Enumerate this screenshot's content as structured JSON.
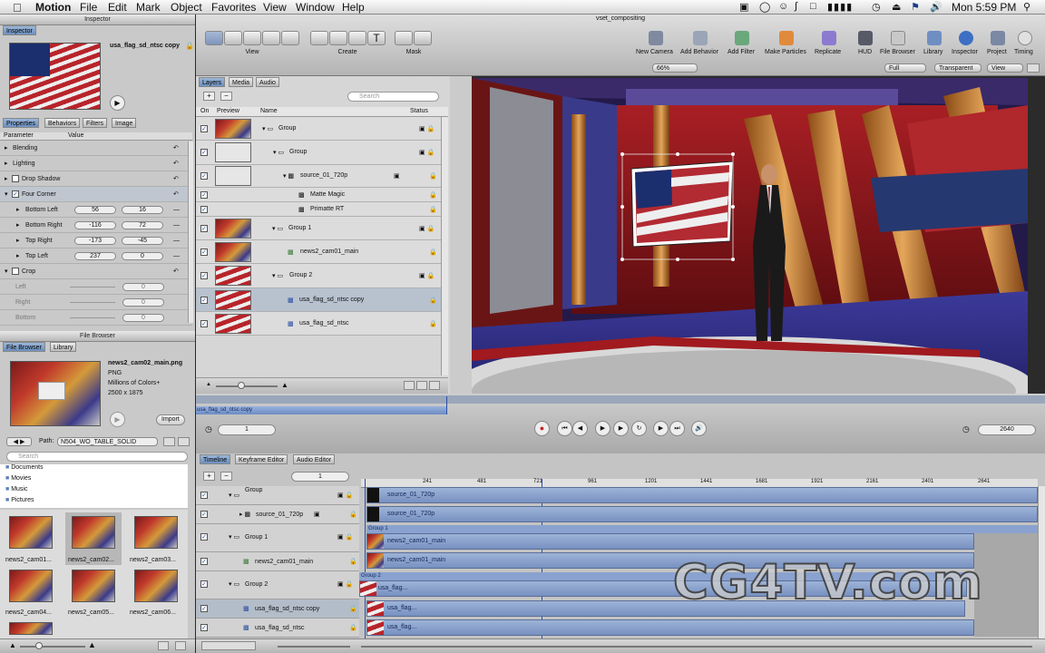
{
  "menubar": {
    "apple": "",
    "app": "Motion",
    "items": [
      "File",
      "Edit",
      "Mark",
      "Object",
      "Favorites",
      "View",
      "Window",
      "Help"
    ],
    "clock": "Mon 5:59 PM"
  },
  "inspector": {
    "title": "Inspector",
    "tab": "Inspector",
    "preview_name": "usa_flag_sd_ntsc copy",
    "tabs": [
      "Properties",
      "Behaviors",
      "Filters",
      "Image"
    ],
    "columns": [
      "Parameter",
      "Value"
    ],
    "params": [
      {
        "label": "Blending",
        "type": "group"
      },
      {
        "label": "Lighting",
        "type": "group"
      },
      {
        "label": "Drop Shadow",
        "type": "group"
      },
      {
        "label": "Four Corner",
        "type": "group"
      },
      {
        "label": "Bottom Left",
        "v1": "56",
        "v2": "16"
      },
      {
        "label": "Bottom Right",
        "v1": "-116",
        "v2": "72"
      },
      {
        "label": "Top Right",
        "v1": "-173",
        "v2": "-45"
      },
      {
        "label": "Top Left",
        "v1": "237",
        "v2": "0"
      },
      {
        "label": "Crop",
        "type": "group"
      },
      {
        "label": "Left",
        "v1": "0"
      },
      {
        "label": "Right",
        "v1": "0"
      },
      {
        "label": "Bottom",
        "v1": "0"
      }
    ]
  },
  "filebrowser": {
    "title": "File Browser",
    "tabs": [
      "File Browser",
      "Library"
    ],
    "filename": "news2_cam02_main.png",
    "type": "PNG",
    "colors": "Millions of Colors+",
    "dims": "2500 x 1875",
    "import_label": "Import",
    "path_label": "Path:",
    "path_value": "N504_WO_TABLE_SOLID",
    "search_placeholder": "Search",
    "folders": [
      "Documents",
      "Movies",
      "Music",
      "Pictures"
    ],
    "files": [
      "news2_cam01...",
      "news2_cam02...",
      "news2_cam03...",
      "news2_cam04...",
      "news2_cam05...",
      "news2_cam06..."
    ]
  },
  "window": {
    "title": "vset_compositing"
  },
  "toolbar": {
    "groups": [
      "View",
      "Create",
      "Mask"
    ],
    "right": [
      "New Camera",
      "Add Behavior",
      "Add Filter",
      "Make Particles",
      "Replicate",
      "HUD",
      "File Browser",
      "Library",
      "Inspector",
      "Project",
      "Timing"
    ],
    "zoom": "66%",
    "quality": "Full",
    "bg": "Transparent",
    "view": "View"
  },
  "layers": {
    "tabs": [
      "Layers",
      "Media",
      "Audio"
    ],
    "search_placeholder": "Search",
    "columns": [
      "On",
      "Preview",
      "Name",
      "Status"
    ],
    "rows": [
      "Group",
      "Group",
      "source_01_720p",
      "Matte Magic",
      "Primatte RT",
      "Group 1",
      "news2_cam01_main",
      "Group 2",
      "usa_flag_sd_ntsc copy",
      "usa_flag_sd_ntsc"
    ]
  },
  "transport": {
    "clip_label": "usa_flag_sd_ntsc copy",
    "start": "1",
    "end": "2640"
  },
  "timeline": {
    "tabs": [
      "Timeline",
      "Keyframe Editor",
      "Audio Editor"
    ],
    "frame": "1",
    "ruler": [
      "241",
      "481",
      "721",
      "961",
      "1201",
      "1441",
      "1681",
      "1921",
      "2161",
      "2401",
      "2641"
    ],
    "rows": [
      "Group",
      "source_01_720p",
      "Group 1",
      "news2_cam01_main",
      "Group 2",
      "usa_flag_sd_ntsc copy",
      "usa_flag_sd_ntsc"
    ],
    "bars": [
      "source_01_720p",
      "source_01_720p",
      "Group 1",
      "news2_cam01_main",
      "news2_cam01_main",
      "Group 2",
      "usa_flag...",
      "usa_flag...",
      "usa_flag..."
    ]
  },
  "watermark": "CG4TV.com",
  "colors": {
    "accent": "#5b7fb8",
    "bar": "#8aa2cf"
  }
}
